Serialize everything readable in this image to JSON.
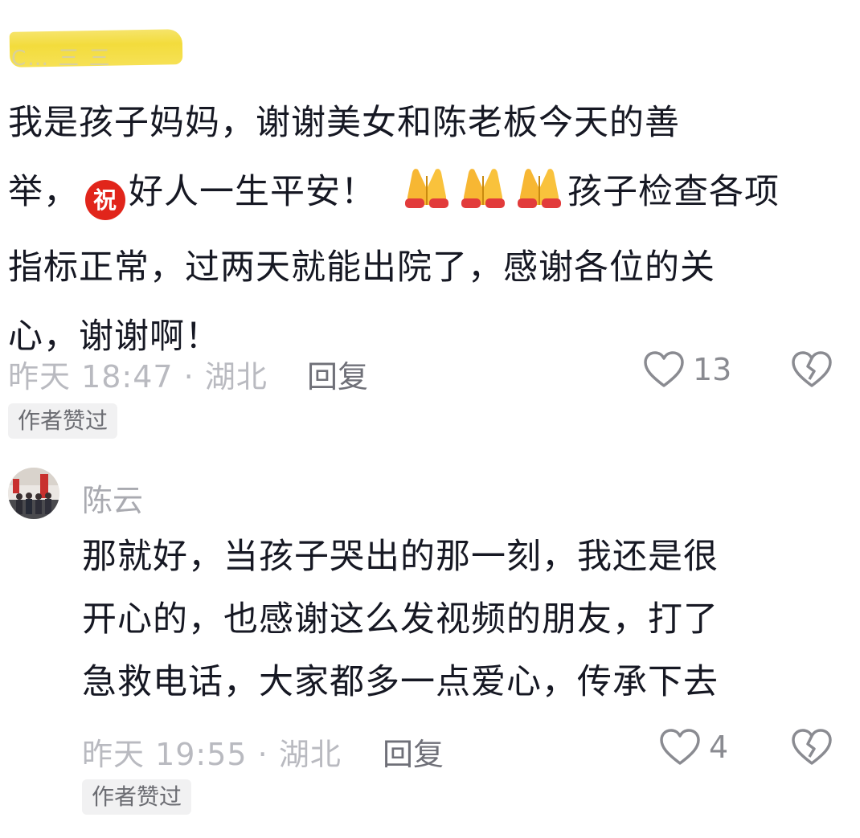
{
  "comments": [
    {
      "author": "C… 三 三",
      "lines": [
        "我是孩子妈妈，谢谢美女和陈老板今天的善",
        "举，",
        "好人一生平安！",
        "孩子检查各项",
        "指标正常，过两天就能出院了，感谢各位的关",
        "心，谢谢啊！"
      ],
      "emoji_zhu": "祝",
      "time_location": "昨天 18:47 · 湖北",
      "reply_label": "回复",
      "like_count": "13",
      "badge": "作者赞过"
    },
    {
      "author": "陈云",
      "lines": [
        "那就好，当孩子哭出的那一刻，我还是很",
        "开心的，也感谢这么发视频的朋友，打了",
        "急救电话，大家都多一点爱心，传承下去"
      ],
      "time_location": "昨天 19:55 · 湖北",
      "reply_label": "回复",
      "like_count": "4",
      "badge": "作者赞过"
    }
  ],
  "icons": {
    "like": "heart-outline-icon",
    "dislike": "broken-heart-icon",
    "pray": "folded-hands-emoji"
  }
}
